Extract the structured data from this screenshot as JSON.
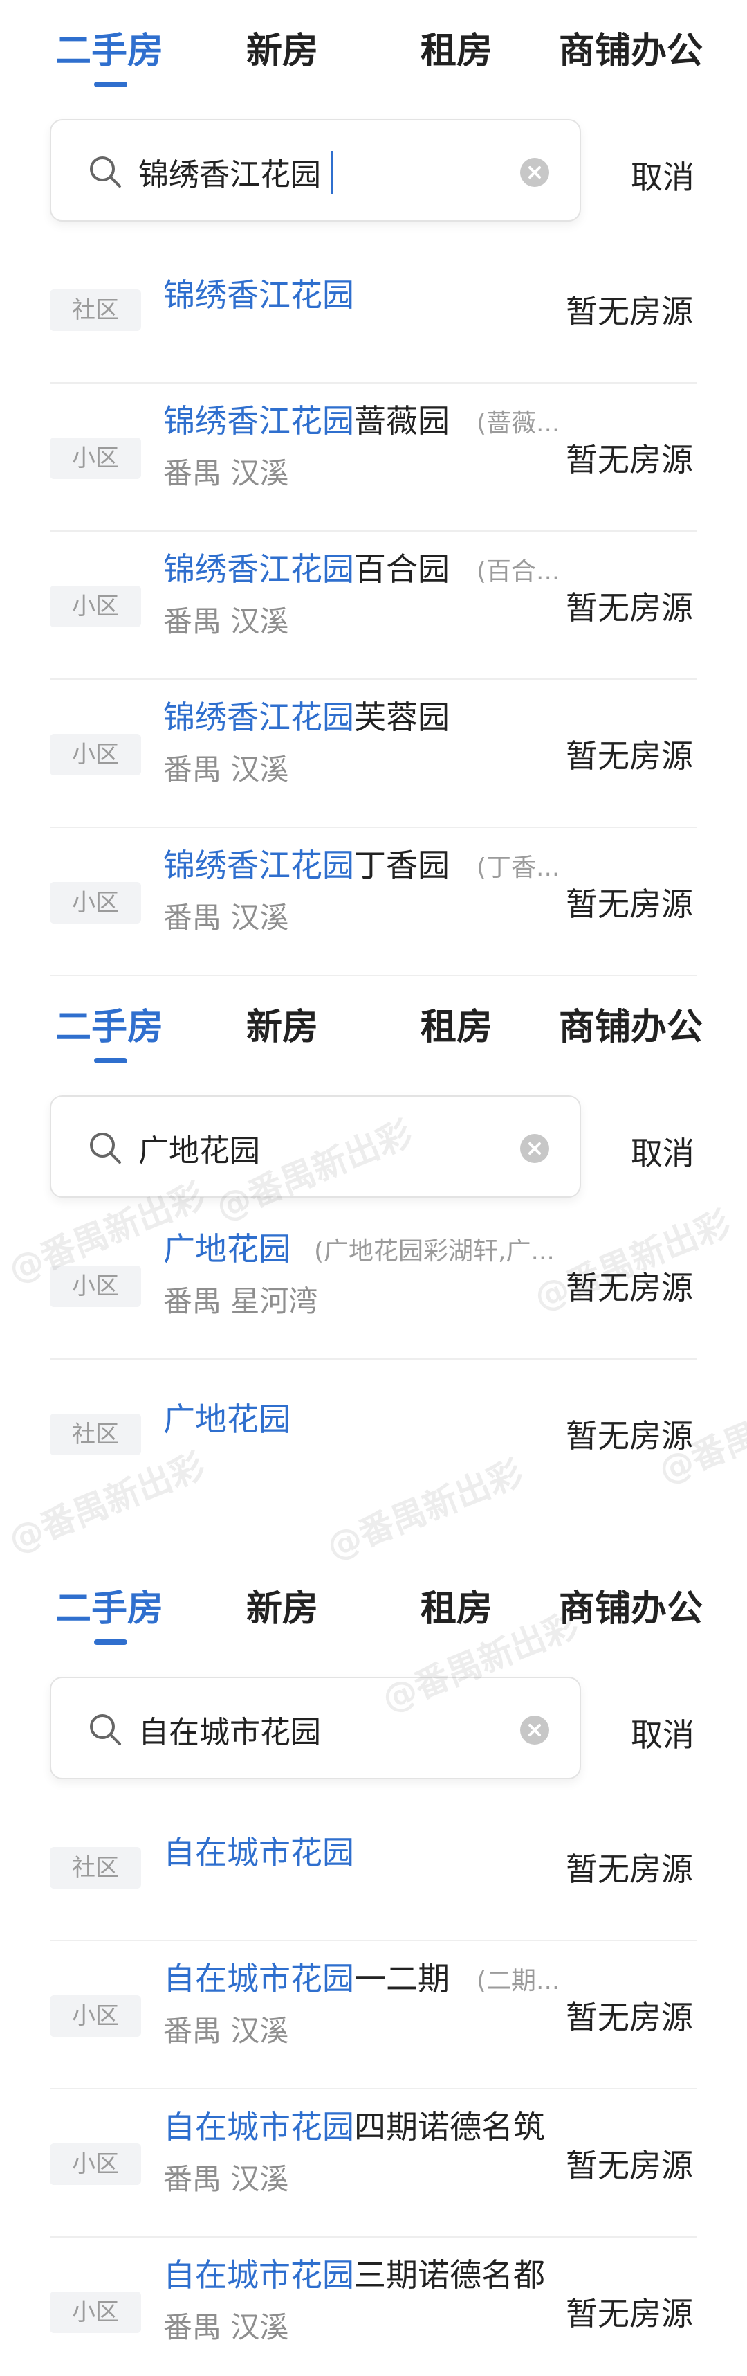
{
  "tabs": [
    "二手房",
    "新房",
    "租房",
    "商铺办公"
  ],
  "cancel_label": "取消",
  "status_label": "暂无房源",
  "watermark": "@番禺新出彩",
  "panels": [
    {
      "query": "锦绣香江花园",
      "results": [
        {
          "tag": "社区",
          "highlight": "锦绣香江花园",
          "suffix": "",
          "alias": "",
          "area": "",
          "status": "暂无房源"
        },
        {
          "tag": "小区",
          "highlight": "锦绣香江花园",
          "suffix": "蔷薇园",
          "alias": "(蔷薇...",
          "area": "番禺 汉溪",
          "status": "暂无房源"
        },
        {
          "tag": "小区",
          "highlight": "锦绣香江花园",
          "suffix": "百合园",
          "alias": "(百合...",
          "area": "番禺 汉溪",
          "status": "暂无房源"
        },
        {
          "tag": "小区",
          "highlight": "锦绣香江花园",
          "suffix": "芙蓉园",
          "alias": "",
          "area": "番禺 汉溪",
          "status": "暂无房源"
        },
        {
          "tag": "小区",
          "highlight": "锦绣香江花园",
          "suffix": "丁香园",
          "alias": "(丁香...",
          "area": "番禺 汉溪",
          "status": "暂无房源"
        }
      ]
    },
    {
      "query": "广地花园",
      "results": [
        {
          "tag": "小区",
          "highlight": "广地花园",
          "suffix": "",
          "alias": "(广地花园彩湖轩,广...",
          "area": "番禺 星河湾",
          "status": "暂无房源"
        },
        {
          "tag": "社区",
          "highlight": "广地花园",
          "suffix": "",
          "alias": "",
          "area": "",
          "status": "暂无房源"
        }
      ]
    },
    {
      "query": "自在城市花园",
      "results": [
        {
          "tag": "社区",
          "highlight": "自在城市花园",
          "suffix": "",
          "alias": "",
          "area": "",
          "status": "暂无房源"
        },
        {
          "tag": "小区",
          "highlight": "自在城市花园",
          "suffix": "一二期",
          "alias": "(二期...",
          "area": "番禺 汉溪",
          "status": "暂无房源"
        },
        {
          "tag": "小区",
          "highlight": "自在城市花园",
          "suffix": "四期诺德名筑",
          "alias": "",
          "area": "番禺 汉溪",
          "status": "暂无房源"
        },
        {
          "tag": "小区",
          "highlight": "自在城市花园",
          "suffix": "三期诺德名都",
          "alias": "",
          "area": "番禺 汉溪",
          "status": "暂无房源"
        }
      ]
    }
  ],
  "colors": {
    "accent": "#2f6fce",
    "text": "#222222",
    "muted": "#9b9b9b"
  }
}
